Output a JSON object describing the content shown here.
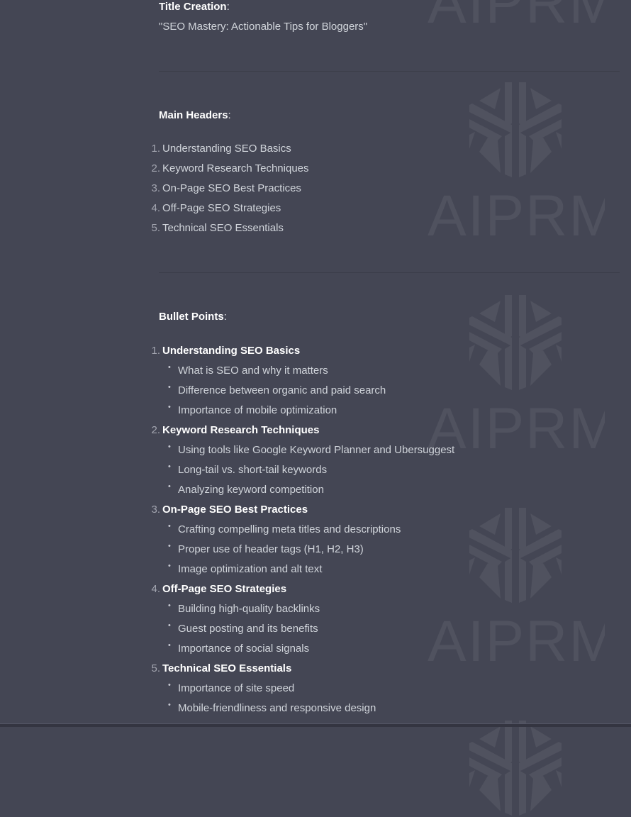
{
  "watermark": {
    "text": "AIPRM",
    "icon": "aiprm-logo-icon"
  },
  "title_section": {
    "label": "Title Creation",
    "colon": ":",
    "value": "\"SEO Mastery: Actionable Tips for Bloggers\""
  },
  "main_headers": {
    "label": "Main Headers",
    "colon": ":",
    "items": [
      {
        "num": "1.",
        "text": "Understanding SEO Basics"
      },
      {
        "num": "2.",
        "text": "Keyword Research Techniques"
      },
      {
        "num": "3.",
        "text": "On-Page SEO Best Practices"
      },
      {
        "num": "4.",
        "text": "Off-Page SEO Strategies"
      },
      {
        "num": "5.",
        "text": "Technical SEO Essentials"
      }
    ]
  },
  "bullet_points": {
    "label": "Bullet Points",
    "colon": ":",
    "bullet_glyph": "•",
    "sections": [
      {
        "num": "1.",
        "title": "Understanding SEO Basics",
        "bullets": [
          "What is SEO and why it matters",
          "Difference between organic and paid search",
          "Importance of mobile optimization"
        ]
      },
      {
        "num": "2.",
        "title": "Keyword Research Techniques",
        "bullets": [
          "Using tools like Google Keyword Planner and Ubersuggest",
          "Long-tail vs. short-tail keywords",
          "Analyzing keyword competition"
        ]
      },
      {
        "num": "3.",
        "title": "On-Page SEO Best Practices",
        "bullets": [
          "Crafting compelling meta titles and descriptions",
          "Proper use of header tags (H1, H2, H3)",
          "Image optimization and alt text"
        ]
      },
      {
        "num": "4.",
        "title": "Off-Page SEO Strategies",
        "bullets": [
          "Building high-quality backlinks",
          "Guest posting and its benefits",
          "Importance of social signals"
        ]
      },
      {
        "num": "5.",
        "title": "Technical SEO Essentials",
        "bullets": [
          "Importance of site speed",
          "Mobile-friendliness and responsive design"
        ]
      }
    ]
  }
}
